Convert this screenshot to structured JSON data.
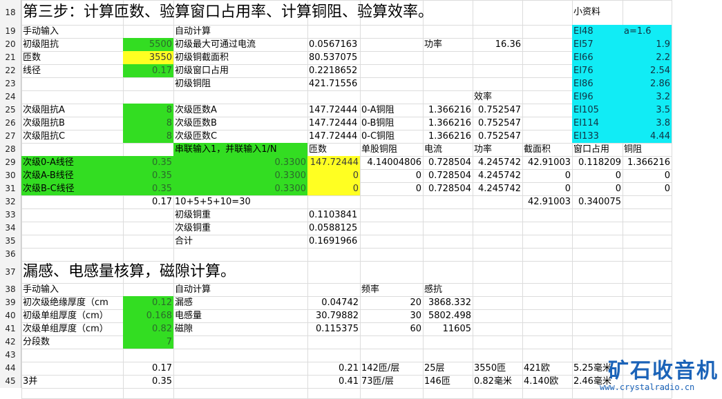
{
  "row_numbers": [
    "18",
    "19",
    "20",
    "21",
    "22",
    "23",
    "24",
    "25",
    "26",
    "27",
    "28",
    "29",
    "30",
    "31",
    "32",
    "33",
    "34",
    "35",
    "36",
    "37",
    "38",
    "39",
    "40",
    "41",
    "42",
    "43",
    "44",
    "45"
  ],
  "row18": {
    "title": "第三步：计算匝数、验算窗口占用率、计算铜阻、验算效率。",
    "ref_label": "小资料"
  },
  "row19": {
    "manual": "手动输入",
    "auto": "自动计算",
    "ei48": "EI48",
    "ei48_val": "a=1.6"
  },
  "row20": {
    "label": "初级阻抗",
    "input": "5500",
    "auto_label": "初级最大可通过电流",
    "auto_val": "0.0567163",
    "power_label": "功率",
    "power_val": "16.36",
    "ei": "EI57",
    "ei_val": "1.9"
  },
  "row21": {
    "label": "匝数",
    "input": "3550",
    "auto_label": "初级铜截面积",
    "auto_val": "80.537075",
    "ei": "EI66",
    "ei_val": "2.2"
  },
  "row22": {
    "label": "线径",
    "input": "0.17",
    "auto_label": "初级窗口占用",
    "auto_val": "0.2218652",
    "ei": "EI76",
    "ei_val": "2.54"
  },
  "row23": {
    "auto_label": "初级铜阻",
    "auto_val": "421.71556",
    "ei": "EI86",
    "ei_val": "2.86"
  },
  "row24": {
    "eff_label": "效率",
    "ei": "EI96",
    "ei_val": "3.2"
  },
  "row25": {
    "label": "次级阻抗A",
    "input": "8",
    "auto_label": "次级匝数A",
    "auto_val": "147.72444",
    "res_label": "0-A铜阻",
    "res_val": "1.366216",
    "eff_val": "0.752547",
    "ei": "EI105",
    "ei_val": "3.5"
  },
  "row26": {
    "label": "次级阻抗B",
    "input": "8",
    "auto_label": "次级匝数B",
    "auto_val": "147.72444",
    "res_label": "0-B铜阻",
    "res_val": "1.366216",
    "eff_val": "0.752547",
    "ei": "EI114",
    "ei_val": "3.8"
  },
  "row27": {
    "label": "次级阻抗C",
    "input": "8",
    "auto_label": "次级匝数C",
    "auto_val": "147.72444",
    "res_label": "0-C铜阻",
    "res_val": "1.366216",
    "eff_val": "0.752547",
    "ei": "EI133",
    "ei_val": "4.44"
  },
  "row28": {
    "mode_label": "串联输入1，并联输入1/N",
    "h_turns": "匝数",
    "h_strand": "单股铜阻",
    "h_current": "电流",
    "h_power": "功率",
    "h_area": "截面积",
    "h_window": "窗口占用",
    "h_res": "铜阻"
  },
  "rows29_31": [
    {
      "label": "次级0-A线径",
      "diam": "0.35",
      "mode": "0.3300",
      "turns": "147.72444",
      "strand": "4.14004806",
      "current": "0.728504",
      "power": "4.245742",
      "area": "42.91003",
      "window": "0.118209",
      "res": "1.366216"
    },
    {
      "label": "次级A-B线径",
      "diam": "0.35",
      "mode": "0.3300",
      "turns": "0",
      "strand": "0",
      "current": "0.728504",
      "power": "4.245742",
      "area": "0",
      "window": "0",
      "res": "0"
    },
    {
      "label": "次级B-C线径",
      "diam": "0.35",
      "mode": "0.3300",
      "turns": "0",
      "strand": "0",
      "current": "0.728504",
      "power": "4.245742",
      "area": "0",
      "window": "0",
      "res": "0"
    }
  ],
  "row32": {
    "val": "0.17",
    "formula": "10+5+5+10=30",
    "area": "42.91003",
    "window": "0.340075"
  },
  "row33": {
    "label": "初级铜重",
    "val": "0.1103841"
  },
  "row34": {
    "label": "次级铜重",
    "val": "0.0588125"
  },
  "row35": {
    "label": "合计",
    "val": "0.1691966"
  },
  "row37": {
    "title": "漏感、电感量核算，磁隙计算。"
  },
  "row38": {
    "manual": "手动输入",
    "auto": "自动计算",
    "freq": "频率",
    "react": "感抗"
  },
  "row39": {
    "label": "初次级绝缘厚度（cm",
    "input": "0.12",
    "auto_label": "漏感",
    "auto_val": "0.04742",
    "freq": "20",
    "react": "3868.332"
  },
  "row40": {
    "label": "初级单组厚度（cm）",
    "input": "0.168",
    "auto_label": "电感量",
    "auto_val": "30.79882",
    "freq": "30",
    "react": "5802.498"
  },
  "row41": {
    "label": "次级单组厚度（cm）",
    "input": "0.82",
    "auto_label": "磁隙",
    "auto_val": "0.115375",
    "freq": "60",
    "react": "11605"
  },
  "row42": {
    "label": "分段数",
    "input": "7"
  },
  "row44": {
    "a": "0.17",
    "b": "0.21",
    "c": "142匝/层",
    "d": "25层",
    "e": "3550匝",
    "f": "421欧",
    "g": "5.25毫米"
  },
  "row45": {
    "label": "3并",
    "a": "0.35",
    "b": "0.41",
    "c": "73匝/层",
    "d": "146匝",
    "e": "0.82毫米",
    "f": "4.140欧",
    "g": "2.46毫米"
  },
  "watermark": {
    "cn": "矿石收音机",
    "url": "www.crystalradio.cn"
  },
  "colors": {
    "green": "#33dd22",
    "yellow": "#ffff22",
    "cyan": "#11ecf5",
    "watermark": "#1b63b8"
  }
}
